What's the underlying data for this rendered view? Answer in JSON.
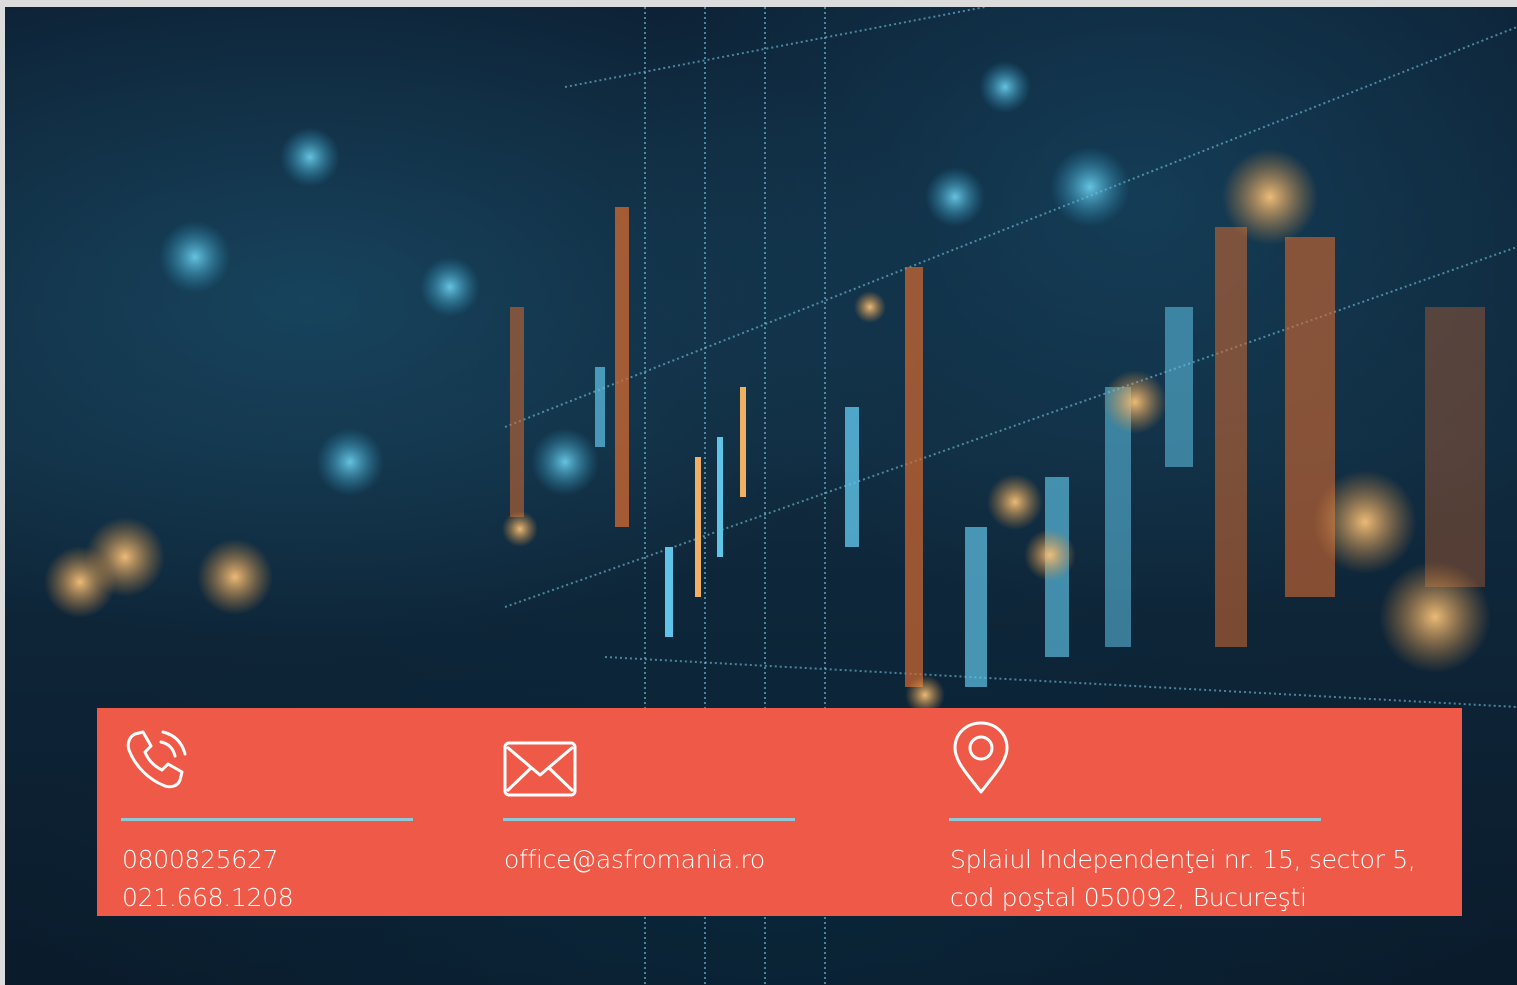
{
  "colors": {
    "band": "#ef5a48",
    "divider": "#8fc9d8",
    "text": "#ffffff"
  },
  "contact": {
    "phone": {
      "icon": "phone-icon",
      "lines": [
        "0800825627",
        "021.668.1208"
      ]
    },
    "email": {
      "icon": "envelope-icon",
      "lines": [
        "office@asfromania.ro"
      ]
    },
    "address": {
      "icon": "map-pin-icon",
      "lines": [
        "Splaiul Independenţei nr. 15, sector 5,",
        "cod poştal 050092, Bucureşti"
      ]
    }
  }
}
